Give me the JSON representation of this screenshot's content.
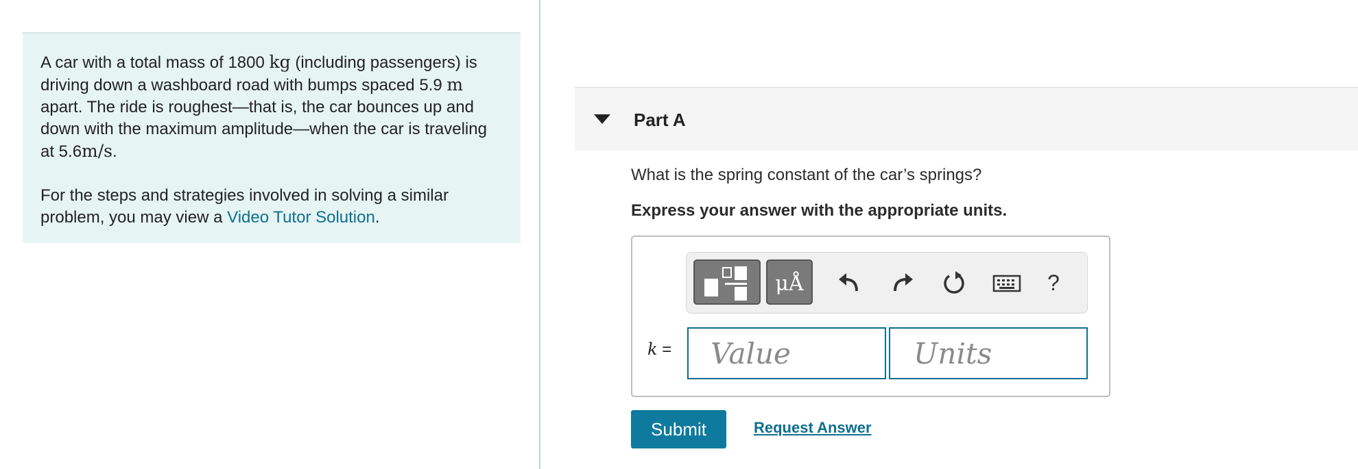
{
  "problem": {
    "para1": {
      "s1": "A car with a total mass of 1800",
      "unit_kg": "kg",
      "s2": "(including passengers) is driving down a washboard road with bumps spaced 5.9",
      "unit_m": "m",
      "s3": "apart. The ride is roughest—that is, the car bounces up and down with the maximum amplitude—when the car is traveling at 5.6",
      "unit_speed": "m/s",
      "s4": "."
    },
    "para2": {
      "text": "For the steps and strategies involved in solving a similar problem, you may view a",
      "link": "Video Tutor Solution",
      "end": "."
    }
  },
  "part": {
    "title": "Part A",
    "question": "What is the spring constant of the car’s springs?",
    "instruction": "Express your answer with the appropriate units."
  },
  "toolbar": {
    "units_symbol": "μÅ",
    "help": "?",
    "icons": [
      "fraction-template-icon",
      "units-icon",
      "undo-icon",
      "redo-icon",
      "reset-icon",
      "keyboard-icon",
      "help-icon"
    ]
  },
  "answer": {
    "variable": "k",
    "equals": "=",
    "value_placeholder": "Value",
    "units_placeholder": "Units"
  },
  "actions": {
    "submit": "Submit",
    "request_answer": "Request Answer"
  },
  "colors": {
    "accent": "#0e7a9e",
    "link": "#0e6f8e",
    "problem_bg": "#e6f5f4",
    "header_bg": "#f5f5f5"
  }
}
